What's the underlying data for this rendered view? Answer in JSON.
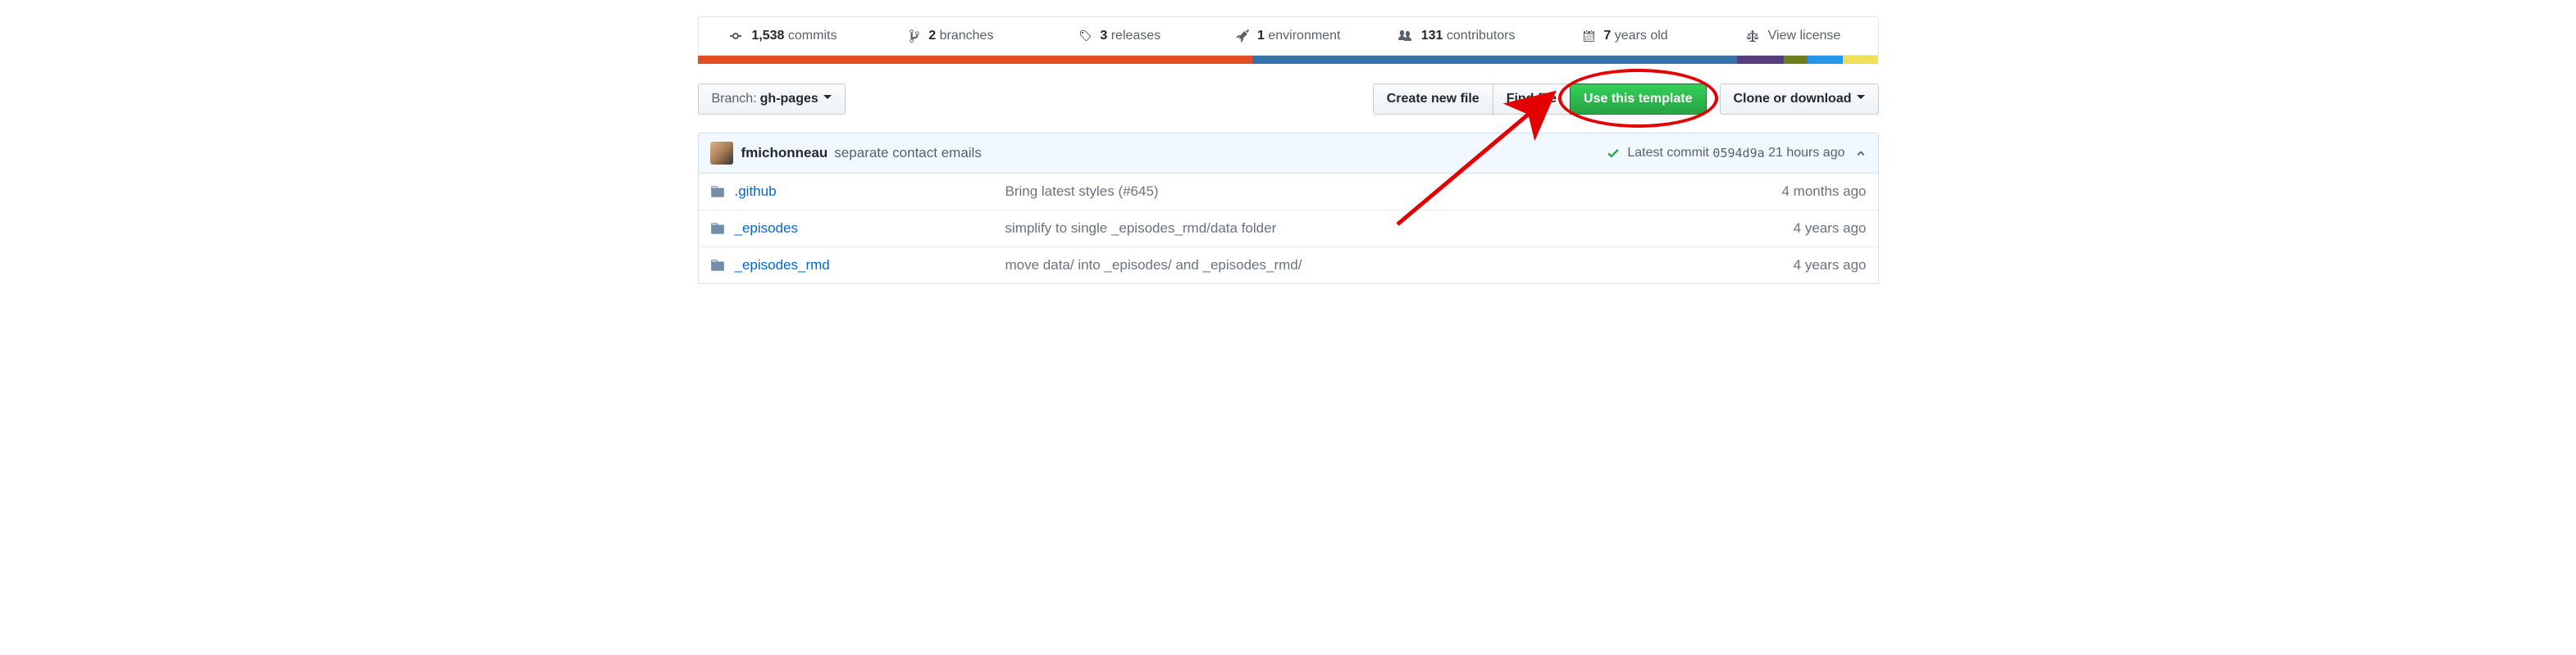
{
  "stats": {
    "commits": {
      "count": "1,538",
      "label": "commits"
    },
    "branches": {
      "count": "2",
      "label": "branches"
    },
    "releases": {
      "count": "3",
      "label": "releases"
    },
    "environment": {
      "count": "1",
      "label": "environment"
    },
    "contributors": {
      "count": "131",
      "label": "contributors"
    },
    "age": {
      "count": "7",
      "label": "years old"
    },
    "license": {
      "label": "View license"
    }
  },
  "langs": [
    {
      "color": "#e34c26",
      "pct": 47
    },
    {
      "color": "#3572A5",
      "pct": 41
    },
    {
      "color": "#563d7c",
      "pct": 4
    },
    {
      "color": "#6e7d22",
      "pct": 2
    },
    {
      "color": "#2496ed",
      "pct": 3
    },
    {
      "color": "#f1e05a",
      "pct": 3
    }
  ],
  "branch": {
    "prefix": "Branch:",
    "name": "gh-pages"
  },
  "buttons": {
    "create": "Create new file",
    "find": "Find file",
    "template": "Use this template",
    "clone": "Clone or download"
  },
  "commit": {
    "author": "fmichonneau",
    "message": "separate contact emails",
    "latest": "Latest commit",
    "sha": "0594d9a",
    "time": "21 hours ago"
  },
  "files": [
    {
      "name": ".github",
      "msg": "Bring latest styles (#645)",
      "age": "4 months ago"
    },
    {
      "name": "_episodes",
      "msg": "simplify to single _episodes_rmd/data folder",
      "age": "4 years ago"
    },
    {
      "name": "_episodes_rmd",
      "msg": "move data/ into _episodes/ and _episodes_rmd/",
      "age": "4 years ago"
    }
  ]
}
